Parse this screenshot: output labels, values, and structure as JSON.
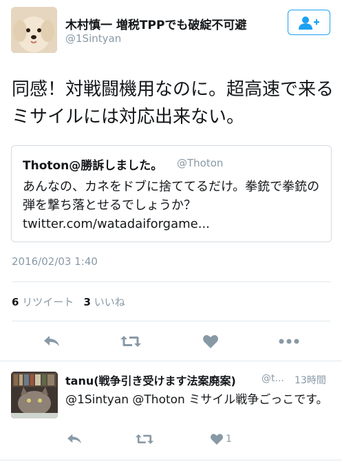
{
  "tweet": {
    "display_name": "木村慎一 増税TPPでも破綻不可避",
    "handle": "@1Sintyan",
    "avatar_icon": "dog-avatar",
    "follow_icon": "follow-user-icon",
    "text": "同感！対戦闘機用なのに。超高速で来るミサイルには対応出来ない。",
    "timestamp": "2016/02/03 1:40",
    "retweets": {
      "count": "6",
      "label": "リツイート"
    },
    "likes": {
      "count": "3",
      "label": "いいね"
    }
  },
  "quote": {
    "author": "Thoton@勝訴しました。",
    "handle": "@Thoton",
    "text": "あんなの、カネをドブに捨ててるだけ。拳銃で拳銃の弾を撃ち落とせるでしょうか？ twitter.com/watadaiforgame..."
  },
  "actions": [
    "reply-icon",
    "retweet-icon",
    "like-icon",
    "more-icon"
  ],
  "reply": {
    "display_name": "tanu(戦争引き受けます法案廃案)",
    "handle": "@t...",
    "time": "13時間",
    "text": "@1Sintyan @Thoton ミサイル戦争ごっこです。",
    "avatar_icon": "cat-avatar",
    "like_count": "1"
  },
  "colors": {
    "accent": "#1da1f2",
    "muted": "#8899a6",
    "text": "#14171a",
    "icon": "#8899a6"
  }
}
